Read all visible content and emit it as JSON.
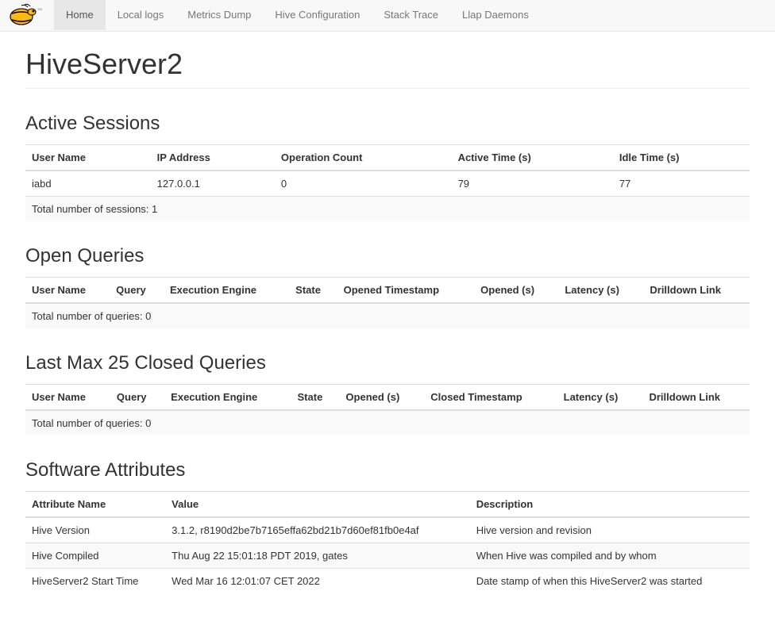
{
  "nav": {
    "items": [
      {
        "label": "Home",
        "active": true
      },
      {
        "label": "Local logs",
        "active": false
      },
      {
        "label": "Metrics Dump",
        "active": false
      },
      {
        "label": "Hive Configuration",
        "active": false
      },
      {
        "label": "Stack Trace",
        "active": false
      },
      {
        "label": "Llap Daemons",
        "active": false
      }
    ]
  },
  "page_title": "HiveServer2",
  "sections": {
    "active_sessions": {
      "title": "Active Sessions",
      "headers": [
        "User Name",
        "IP Address",
        "Operation Count",
        "Active Time (s)",
        "Idle Time (s)"
      ],
      "rows": [
        {
          "user": "iabd",
          "ip": "127.0.0.1",
          "op_count": "0",
          "active_time": "79",
          "idle_time": "77"
        }
      ],
      "summary": "Total number of sessions: 1"
    },
    "open_queries": {
      "title": "Open Queries",
      "headers": [
        "User Name",
        "Query",
        "Execution Engine",
        "State",
        "Opened Timestamp",
        "Opened (s)",
        "Latency (s)",
        "Drilldown Link"
      ],
      "summary": "Total number of queries: 0"
    },
    "closed_queries": {
      "title": "Last Max 25 Closed Queries",
      "headers": [
        "User Name",
        "Query",
        "Execution Engine",
        "State",
        "Opened (s)",
        "Closed Timestamp",
        "Latency (s)",
        "Drilldown Link"
      ],
      "summary": "Total number of queries: 0"
    },
    "software_attributes": {
      "title": "Software Attributes",
      "headers": [
        "Attribute Name",
        "Value",
        "Description"
      ],
      "rows": [
        {
          "name": "Hive Version",
          "value": "3.1.2, r8190d2be7b7165effa62bd21b7d60ef81fb0e4af",
          "desc": "Hive version and revision"
        },
        {
          "name": "Hive Compiled",
          "value": "Thu Aug 22 15:01:18 PDT 2019, gates",
          "desc": "When Hive was compiled and by whom"
        },
        {
          "name": "HiveServer2 Start Time",
          "value": "Wed Mar 16 12:01:07 CET 2022",
          "desc": "Date stamp of when this HiveServer2 was started"
        }
      ]
    }
  }
}
